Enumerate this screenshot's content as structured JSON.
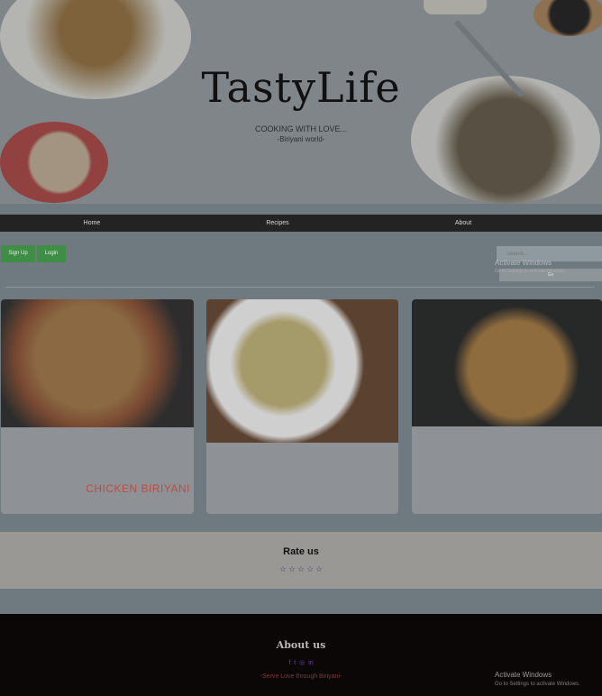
{
  "hero": {
    "brand": "TastyLife",
    "tagline": "COOKING WITH LOVE...",
    "subtag": "-Biriyani world-"
  },
  "nav": {
    "items": [
      {
        "label": "Home"
      },
      {
        "label": "Recipes"
      },
      {
        "label": "About"
      }
    ]
  },
  "actions": {
    "signup_label": "Sign Up",
    "login_label": "Login",
    "search_placeholder": "Search...",
    "go_label": "Go"
  },
  "cards": [
    {
      "title": "CHICKEN BIRIYANI"
    },
    {
      "title": ""
    },
    {
      "title": ""
    }
  ],
  "rating": {
    "title": "Rate us",
    "stars_filled": 0,
    "stars_total": 5
  },
  "footer": {
    "title": "About us",
    "tagline": "-Serve Love through Biriyani-",
    "social_icons": [
      "facebook-icon",
      "twitter-icon",
      "instagram-icon",
      "linkedin-icon"
    ]
  },
  "watermark": {
    "title": "Activate Windows",
    "subtitle": "Go to Settings to activate Windows."
  },
  "colors": {
    "nav_bg": "#232323",
    "button_green": "#3f8e45",
    "card_title_red": "#b94d43",
    "footer_bg": "#0b0707",
    "star_purple": "#4b3a7a"
  }
}
